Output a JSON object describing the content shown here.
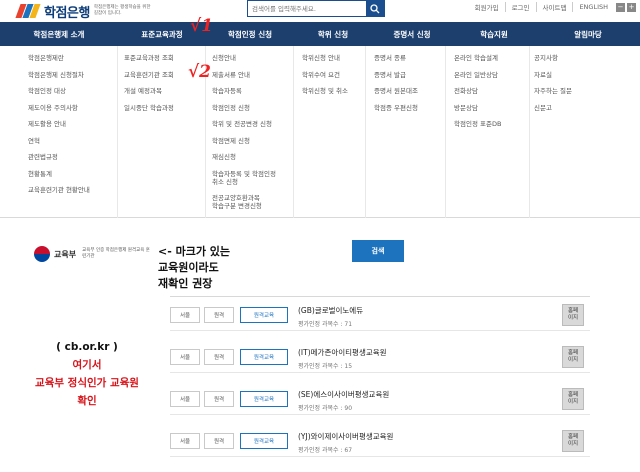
{
  "header": {
    "logo_text": "학점은행",
    "logo_subtext": "학점은행제는 평생학습을 위한 길잡이 입니다.",
    "search_placeholder": "검색어를 입력해주세요.",
    "util_links": [
      "회원가입",
      "로그인",
      "사이트맵",
      "ENGLISH"
    ],
    "zoom": [
      "−",
      "+"
    ]
  },
  "nav": [
    "학점은행제 소개",
    "표준교육과정",
    "학점인정 신청",
    "학위 신청",
    "증명서 신청",
    "학습지원",
    "알림마당"
  ],
  "menu": {
    "col1": [
      "학점은행제란",
      "학점은행제 신청절차",
      "학점인정 대상",
      "제도이용 주의사항",
      "제도활용 안내",
      "연혁",
      "관련법규정",
      "현황통계",
      "교육훈련기관 현황안내"
    ],
    "col2": [
      "표준교육과정 조회",
      "교육훈련기관 조회",
      "개설 예정과목",
      "일시중단 학습과정"
    ],
    "col3": [
      "신청안내",
      "제출서류 안내",
      "학습자등록",
      "학점인정 신청",
      "학위 및 전공변경 신청",
      "학점면제 신청",
      "재심신청",
      [
        "학습자등록 및 학점인정",
        "취소 신청"
      ],
      [
        "전공교양호환과목",
        "학습구분 변경신청"
      ]
    ],
    "col4": [
      "학위신청 안내",
      "학위수여 요건",
      "학위신청 및 취소"
    ],
    "col5": [
      "증명서 종류",
      "증명서 발급",
      "증명서 원본대조",
      "학점증 우편신청"
    ],
    "col6": [
      "온라인 학습설계",
      "온라인 일반상담",
      "전화상담",
      "방문상담",
      "학점인정 표준DB"
    ],
    "col7": [
      "공지사항",
      "자료실",
      "자주하는 질문",
      "신문고"
    ]
  },
  "annotations": {
    "check1": "√1",
    "check2": "√2",
    "note1": [
      "<- 마크가 있는",
      "교육원이라도",
      "재확인 권장"
    ],
    "note2_url": "( cb.or.kr )",
    "note2": [
      "여기서",
      "교육부 정식인가 교육원",
      "확인"
    ]
  },
  "ministry": {
    "name": "교육부",
    "subtext": "교육부 인증 학점은행제 원격교육 훈련기관"
  },
  "search_button": "검색",
  "institutions": [
    {
      "region": "서울",
      "type": "원격",
      "mode": "원격교육",
      "name": "(GB)글로벌이노에듀",
      "meta": "평가인정 과목수 : 71",
      "home": [
        "홈페",
        "이지"
      ]
    },
    {
      "region": "서울",
      "type": "원격",
      "mode": "원격교육",
      "name": "(IT)메가존아이티평생교육원",
      "meta": "평가인정 과목수 : 15",
      "home": [
        "홈페",
        "이지"
      ]
    },
    {
      "region": "서울",
      "type": "원격",
      "mode": "원격교육",
      "name": "(SE)에스이사이버평생교육원",
      "meta": "평가인정 과목수 : 90",
      "home": [
        "홈페",
        "이지"
      ]
    },
    {
      "region": "서울",
      "type": "원격",
      "mode": "원격교육",
      "name": "(YJ)와이제이사이버평생교육원",
      "meta": "평가인정 과목수 : 67",
      "home": [
        "홈페",
        "이지"
      ]
    }
  ],
  "colors": {
    "nav_bg": "#1d3f6e",
    "accent": "#1e73be",
    "annotation_red": "#d8141a"
  }
}
